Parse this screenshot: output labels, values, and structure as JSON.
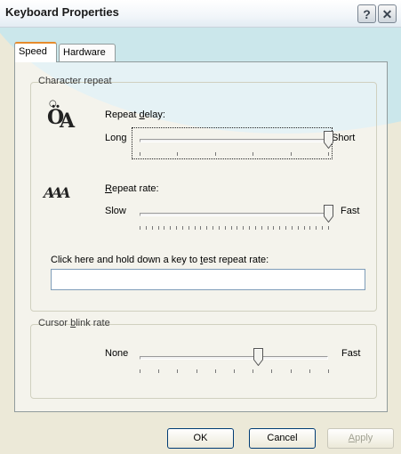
{
  "window": {
    "title": "Keyboard Properties",
    "help_label": "?",
    "close_label": "✕"
  },
  "tabs": [
    {
      "label": "Speed",
      "active": true
    },
    {
      "label": "Hardware",
      "active": false
    }
  ],
  "character_repeat": {
    "legend": "Character repeat",
    "repeat_delay": {
      "label_pre": "Repeat ",
      "label_accel": "d",
      "label_post": "elay:",
      "min_label": "Long",
      "max_label": "Short",
      "value_fraction": 1.0
    },
    "repeat_rate": {
      "label_accel": "R",
      "label_post": "epeat rate:",
      "min_label": "Slow",
      "max_label": "Fast",
      "value_fraction": 1.0
    },
    "test_prompt_pre": "Click here and hold down a key to ",
    "test_prompt_accel": "t",
    "test_prompt_post": "est repeat rate:",
    "test_value": ""
  },
  "cursor_blink": {
    "legend_pre": "Cursor ",
    "legend_accel": "b",
    "legend_post": "link rate",
    "min_label": "None",
    "max_label": "Fast",
    "value_fraction": 0.63
  },
  "buttons": {
    "ok": "OK",
    "cancel": "Cancel",
    "apply_accel": "A",
    "apply_post": "pply"
  },
  "icons": {
    "repeat_delay": "stopwatch-letter-icon",
    "repeat_rate": "repeating-letters-icon"
  }
}
